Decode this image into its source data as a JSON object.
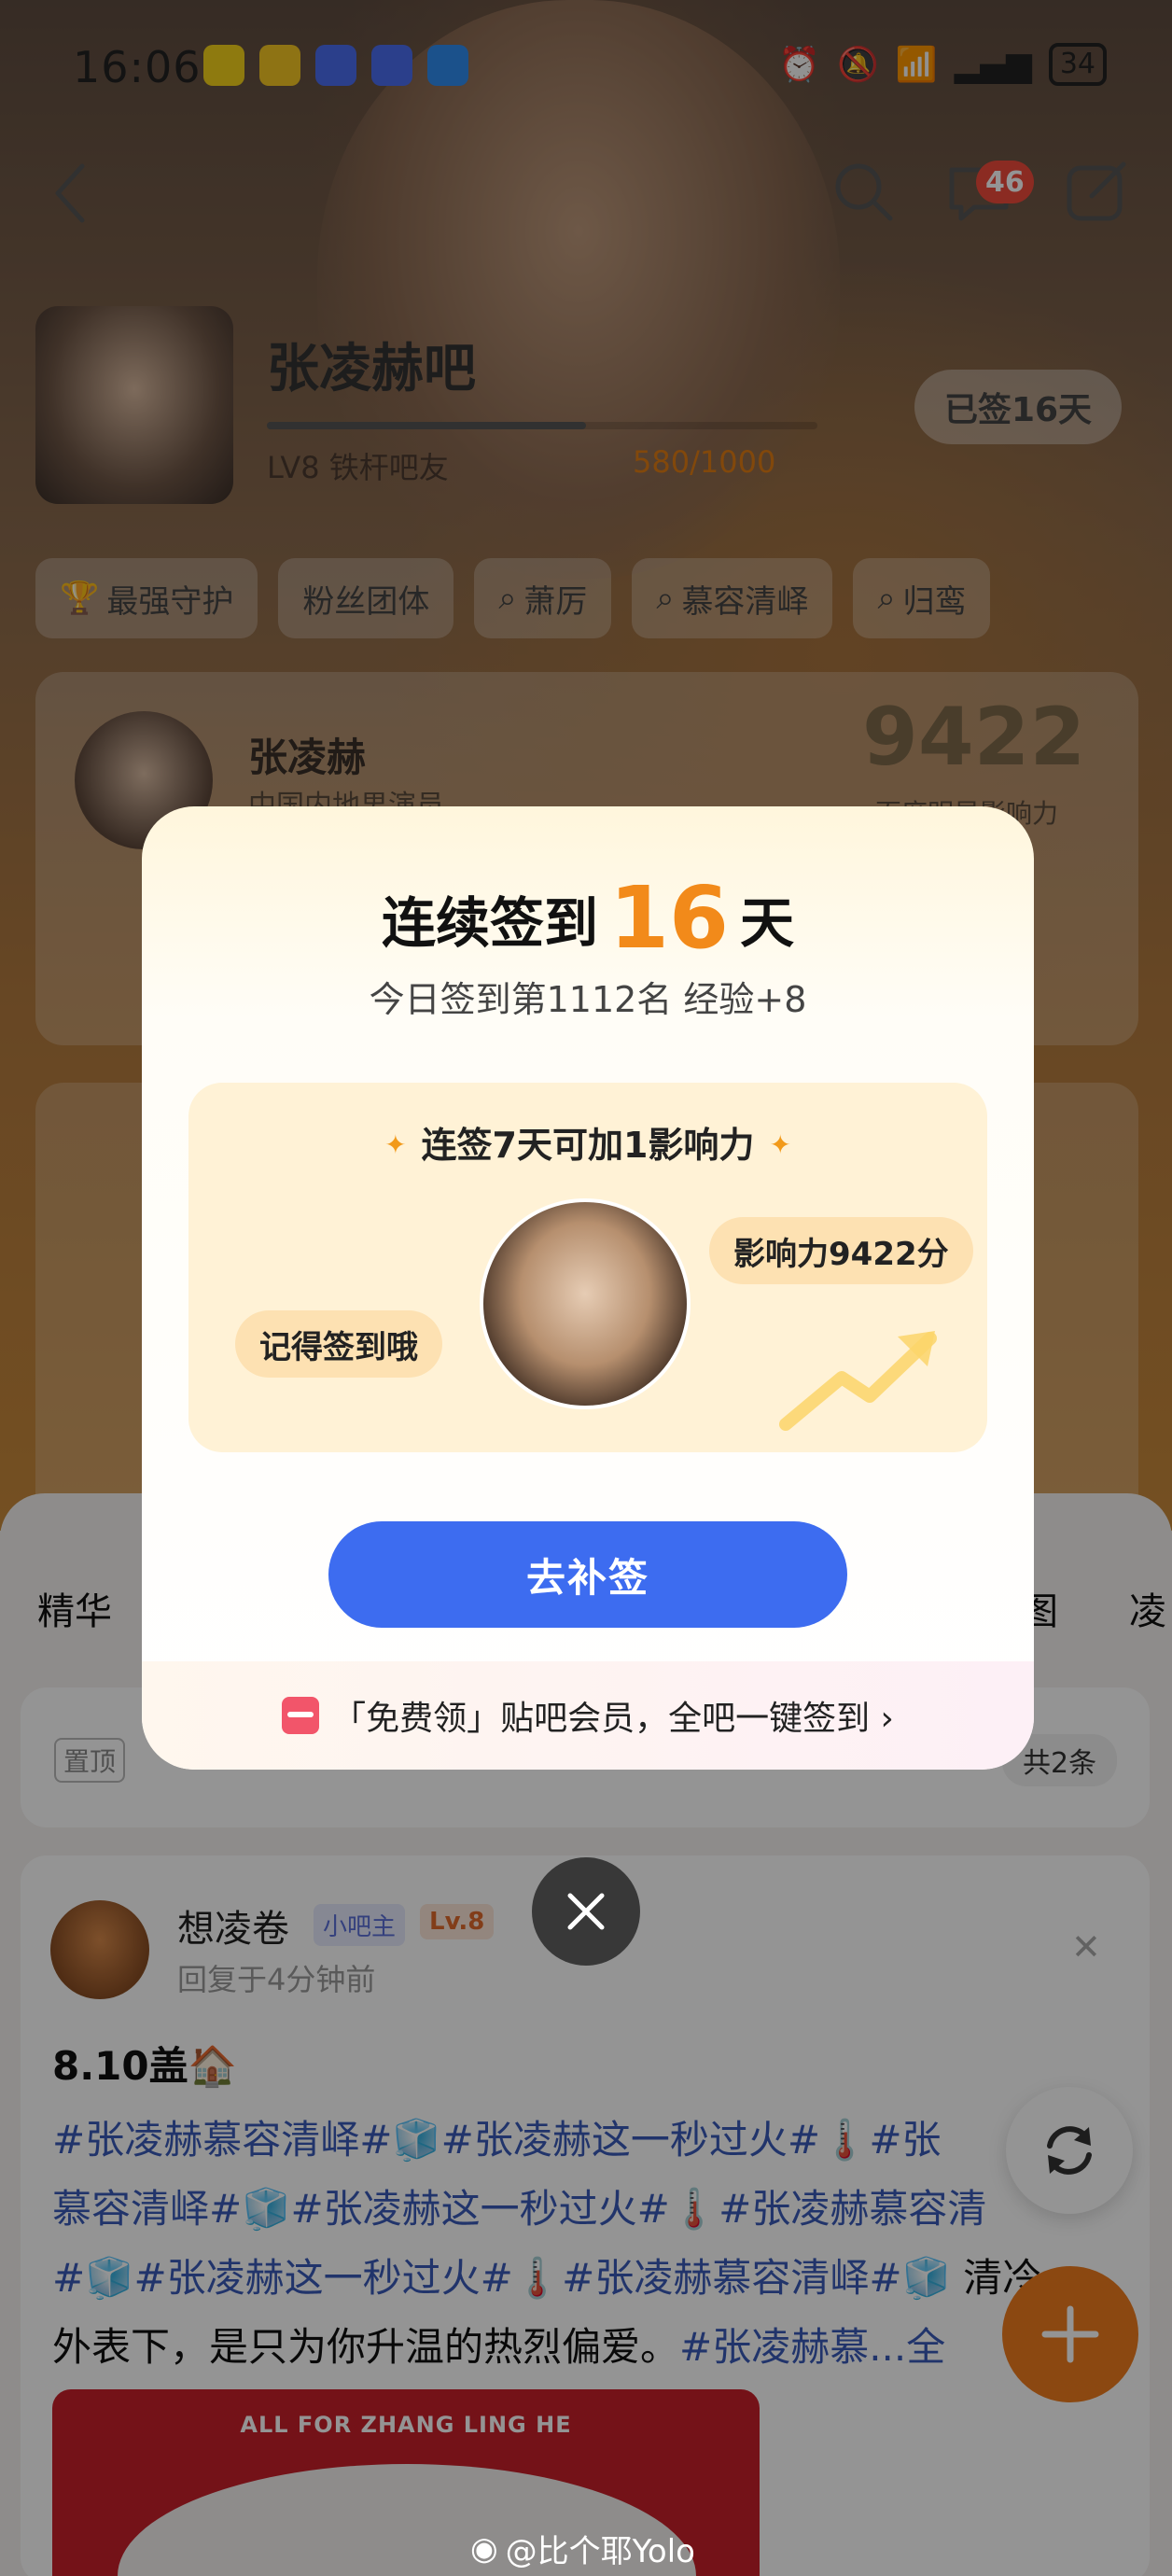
{
  "status_bar": {
    "time": "16:06",
    "battery": "34",
    "app_icons": [
      "app-icon-a",
      "weibo-icon",
      "tieba-icon",
      "tieba-icon",
      "weather-icon"
    ]
  },
  "nav": {
    "message_badge": "46"
  },
  "forum": {
    "name": "张凌赫吧",
    "level_text": "LV8 铁杆吧友",
    "level_score": "580/1000",
    "level_progress": 0.58,
    "signed_label": "已签16天"
  },
  "chips": [
    {
      "label": "最强守护",
      "icon": "trophy-icon"
    },
    {
      "label": "粉丝团体",
      "icon": ""
    },
    {
      "label": "萧厉",
      "icon": "search-icon"
    },
    {
      "label": "慕容清峄",
      "icon": "search-icon"
    },
    {
      "label": "归鸾",
      "icon": "search-icon"
    }
  ],
  "star_card": {
    "name": "张凌赫",
    "subtitle": "中国内地男演员",
    "score": "9422",
    "score_label": "百度明星影响力"
  },
  "feed": {
    "tab_left": "精华",
    "tab_right1": "图",
    "tab_right2": "凌",
    "pinned_tag": "置顶",
    "pinned_count": "共2条"
  },
  "post": {
    "user": "想凌卷",
    "role": "小吧主",
    "level": "Lv.8",
    "time": "回复于4分钟前",
    "title": "8.10盖🏠",
    "body_line1_tag1": "#张凌赫慕容清峄#🧊#张凌赫这一秒过火#🌡️#张",
    "body_line2": "慕容清峄#🧊#张凌赫这一秒过火#🌡️#张凌赫慕容清",
    "body_line3": "#🧊#张凌赫这一秒过火#🌡️#张凌赫慕容清峄#🧊",
    "body_line3_tail": " 清冷",
    "body_line4_text": "外表下，是只为你升温的热烈偏爱。",
    "body_line4_tag": "#张凌赫慕...全",
    "image_caption": "ALL FOR ZHANG LING HE"
  },
  "modal": {
    "title_prefix": "连续签到",
    "title_days": "16",
    "title_suffix": "天",
    "subtitle": "今日签到第1112名 经验+8",
    "inner_heading": "连签7天可加1影响力",
    "bubble_left": "记得签到哦",
    "bubble_right": "影响力9422分",
    "button": "去补签",
    "footer": "「免费领」贴吧会员，全吧一键签到 ›"
  },
  "watermark": "@比个耶Yolo",
  "colors": {
    "accent_orange": "#f28a1a",
    "button_blue": "#3d6cf0",
    "badge_red": "#f04a3c"
  }
}
